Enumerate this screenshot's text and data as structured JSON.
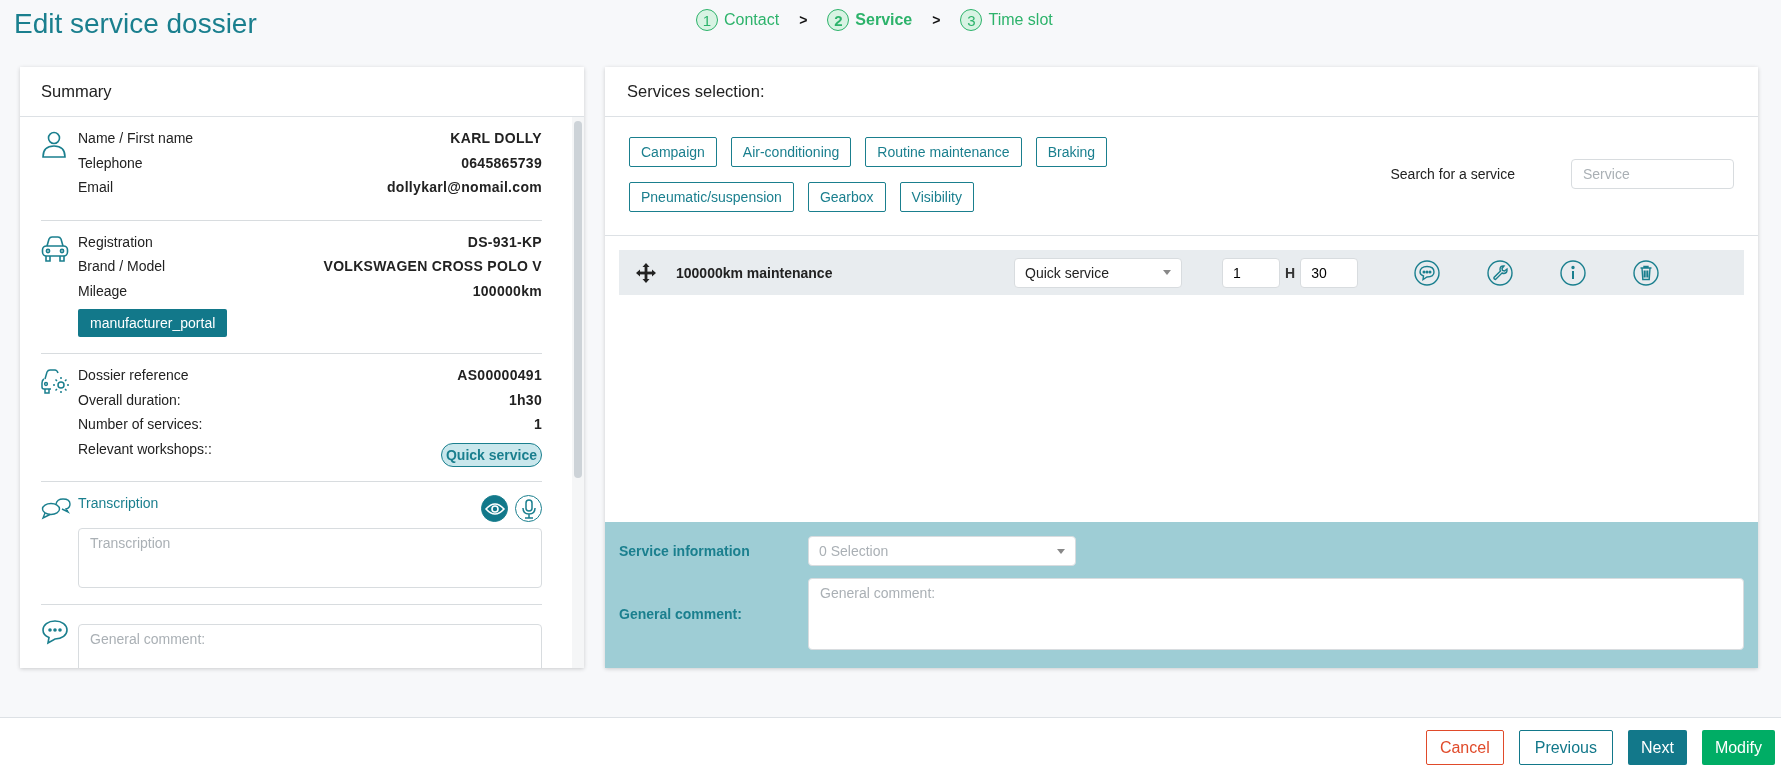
{
  "page_title": "Edit service dossier",
  "steps": [
    {
      "number": "1",
      "label": "Contact",
      "selected": false
    },
    {
      "number": "2",
      "label": "Service",
      "selected": true
    },
    {
      "number": "3",
      "label": "Time slot",
      "selected": false
    }
  ],
  "step_separators": [
    ">",
    ">"
  ],
  "summary": {
    "title": "Summary",
    "sections": [
      {
        "kind": "person",
        "rows": [
          {
            "label": "Name / First name",
            "value": "KARL DOLLY"
          },
          {
            "label": "Telephone",
            "value": "0645865739"
          },
          {
            "label": "Email",
            "value": "dollykarl@nomail.com"
          }
        ]
      },
      {
        "kind": "vehicle",
        "rows": [
          {
            "label": "Registration",
            "value": "DS-931-KP"
          },
          {
            "label": "Brand / Model",
            "value": "VOLKSWAGEN CROSS POLO V"
          },
          {
            "label": "Mileage",
            "value": "100000km"
          }
        ],
        "button": "manufacturer_portal"
      },
      {
        "kind": "dossier",
        "rows": [
          {
            "label": "Dossier reference",
            "value": "AS00000491"
          },
          {
            "label": "Overall duration:",
            "value": "1h30"
          },
          {
            "label": "Number of services:",
            "value": "1"
          },
          {
            "label": "Relevant workshops::",
            "value": ""
          }
        ],
        "badge": "Quick service"
      },
      {
        "kind": "transcription",
        "label": "Transcription",
        "placeholder": "Transcription"
      },
      {
        "kind": "comment",
        "placeholder": "General comment:"
      }
    ]
  },
  "services": {
    "title": "Services selection:",
    "categories": [
      "Campaign",
      "Air-conditioning",
      "Routine maintenance",
      "Braking",
      "Pneumatic/suspension",
      "Gearbox",
      "Visibility"
    ],
    "search_label": "Search for a service",
    "search_placeholder": "Service",
    "rows": [
      {
        "name": "100000km maintenance",
        "type": "Quick service",
        "hours": "1",
        "hour_unit": "H",
        "minutes": "30"
      }
    ],
    "info_label": "Service information",
    "info_placeholder": "0 Selection",
    "comment_label": "General comment:",
    "comment_placeholder": "General comment:"
  },
  "footer_buttons": [
    {
      "label": "Cancel",
      "kind": "cancel"
    },
    {
      "label": "Previous",
      "kind": "secondary"
    },
    {
      "label": "Next",
      "kind": "primary"
    },
    {
      "label": "Modify",
      "kind": "confirm"
    }
  ]
}
